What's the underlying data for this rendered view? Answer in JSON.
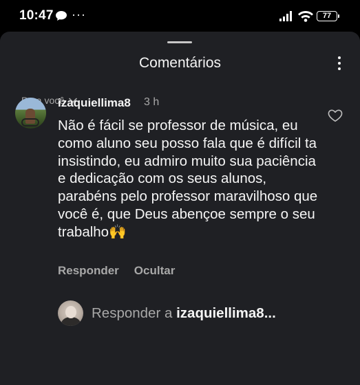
{
  "status_bar": {
    "time": "10:47",
    "more": "···",
    "battery": "77",
    "icons": [
      "chat-bubble-icon",
      "signal-icon",
      "wifi-icon",
      "battery-icon"
    ]
  },
  "sheet": {
    "title": "Comentários",
    "menu_icon": "kebab-icon"
  },
  "filter": {
    "label": "Para você",
    "icon": "chevron-down-icon"
  },
  "comment": {
    "username": "izaquiellima8",
    "time_ago": "3 h",
    "text": "Não é fácil se professor de música, eu como aluno seu posso fala que é difícil ta insistindo, eu admiro muito sua paciência e dedicação com os seus alunos, parabéns pelo professor maravilhoso que você é, que Deus abençoe sempre o seu trabalho🙌",
    "like_icon": "heart-icon",
    "reply_label": "Responder",
    "hide_label": "Ocultar"
  },
  "reply_box": {
    "prefix": "Responder a ",
    "target": "izaquiellima8..."
  },
  "colors": {
    "sheet_bg": "#1f2024",
    "text_primary": "#f5f5f5",
    "text_secondary": "#a8a8a8"
  }
}
